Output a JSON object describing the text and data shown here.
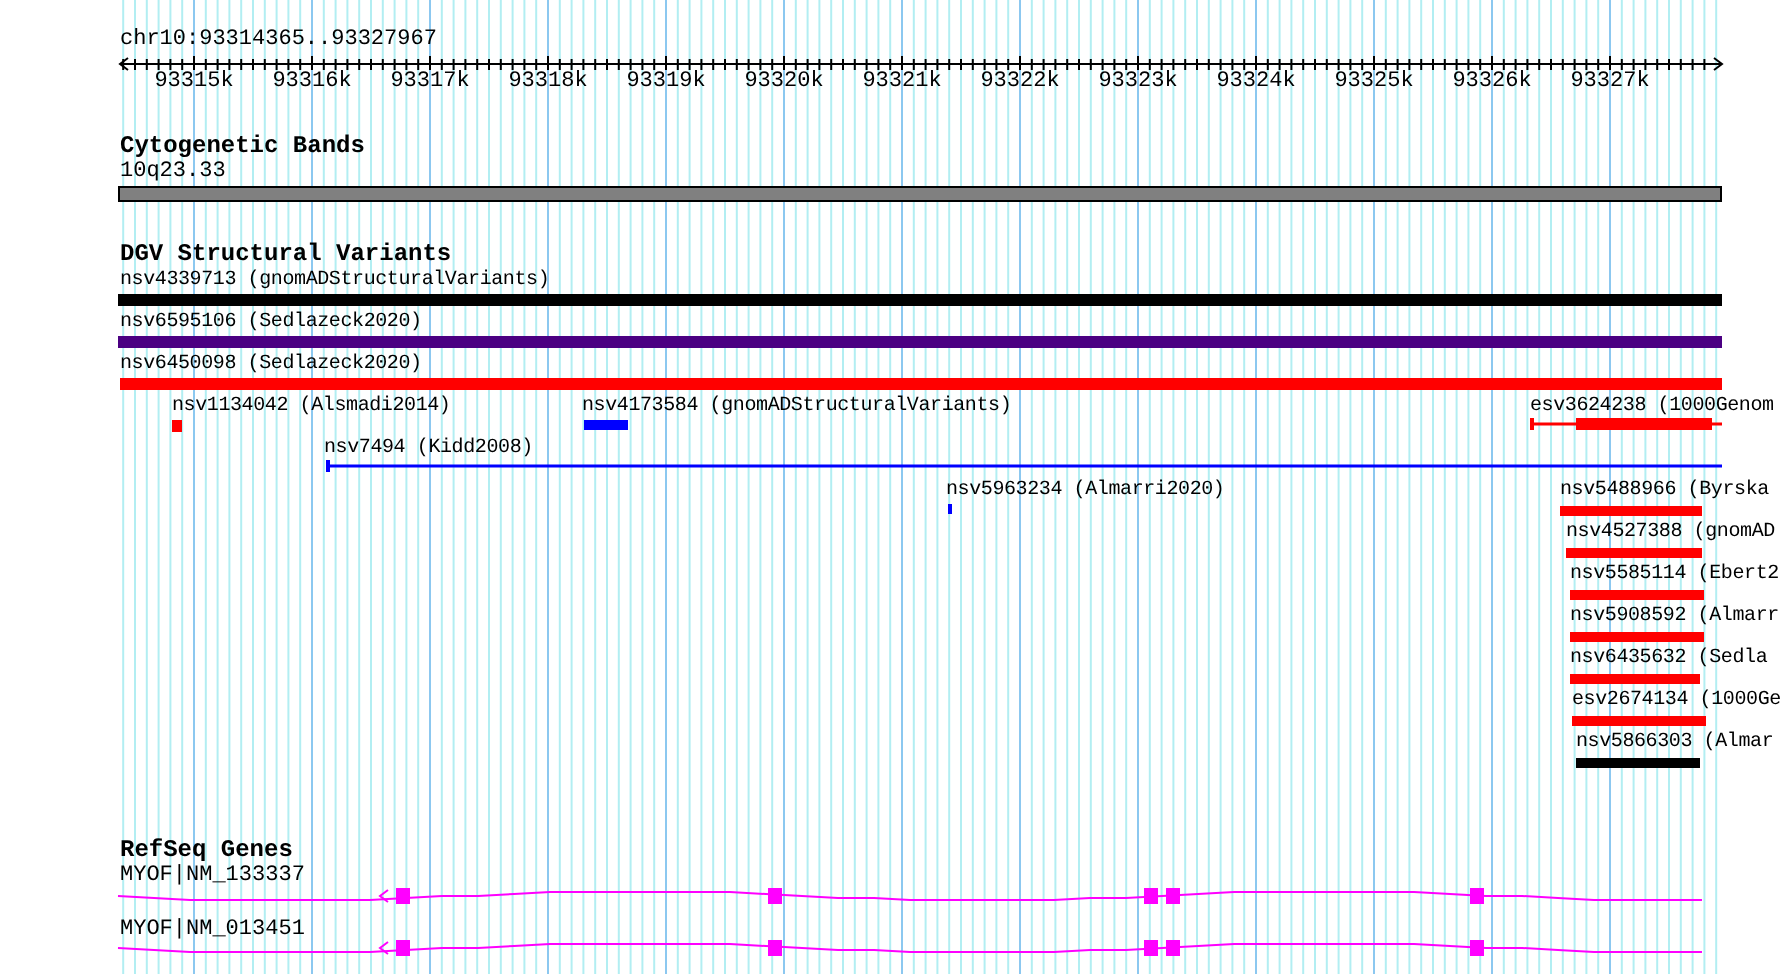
{
  "ruler": {
    "location": "chr10:93314365..93327967",
    "ticks": [
      "93315k",
      "93316k",
      "93317k",
      "93318k",
      "93319k",
      "93320k",
      "93321k",
      "93322k",
      "93323k",
      "93324k",
      "93325k",
      "93326k",
      "93327k"
    ]
  },
  "tracks": [
    {
      "title": "Cytogenetic Bands",
      "features": [
        {
          "label": "10q23.33",
          "kind": "band"
        }
      ]
    },
    {
      "title": "DGV Structural Variants",
      "features": [
        {
          "label": "nsv4339713 (gnomADStructuralVariants)",
          "kind": "bar",
          "color": "#000000"
        },
        {
          "label": "nsv6595106 (Sedlazeck2020)",
          "kind": "bar",
          "color": "#4b0082"
        },
        {
          "label": "nsv6450098 (Sedlazeck2020)",
          "kind": "bar",
          "color": "#ff0000"
        },
        {
          "label": "nsv1134042 (Alsmadi2014)",
          "kind": "bar",
          "color": "#ff0000"
        },
        {
          "label": "nsv4173584 (gnomADStructuralVariants)",
          "kind": "bar",
          "color": "#0000ff"
        },
        {
          "label": "esv3624238 (1000Genom",
          "kind": "line",
          "color": "#ff0000"
        },
        {
          "label": "nsv7494 (Kidd2008)",
          "kind": "line",
          "color": "#0000ff"
        },
        {
          "label": "nsv5963234 (Almarri2020)",
          "kind": "bar",
          "color": "#0000ff"
        },
        {
          "label": "nsv5488966 (Byrska",
          "kind": "bar",
          "color": "#ff0000"
        },
        {
          "label": "nsv4527388 (gnomAD",
          "kind": "bar",
          "color": "#ff0000"
        },
        {
          "label": "nsv5585114 (Ebert2",
          "kind": "bar",
          "color": "#ff0000"
        },
        {
          "label": "nsv5908592 (Almarr",
          "kind": "bar",
          "color": "#ff0000"
        },
        {
          "label": "nsv6435632 (Sedla",
          "kind": "bar",
          "color": "#ff0000"
        },
        {
          "label": "esv2674134 (1000Ge",
          "kind": "bar",
          "color": "#ff0000"
        },
        {
          "label": "nsv5866303 (Almar",
          "kind": "bar",
          "color": "#000000"
        }
      ]
    },
    {
      "title": "RefSeq Genes",
      "features": [
        {
          "label": "MYOF|NM_133337",
          "kind": "gene"
        },
        {
          "label": "MYOF|NM_013451",
          "kind": "gene"
        }
      ]
    }
  ]
}
